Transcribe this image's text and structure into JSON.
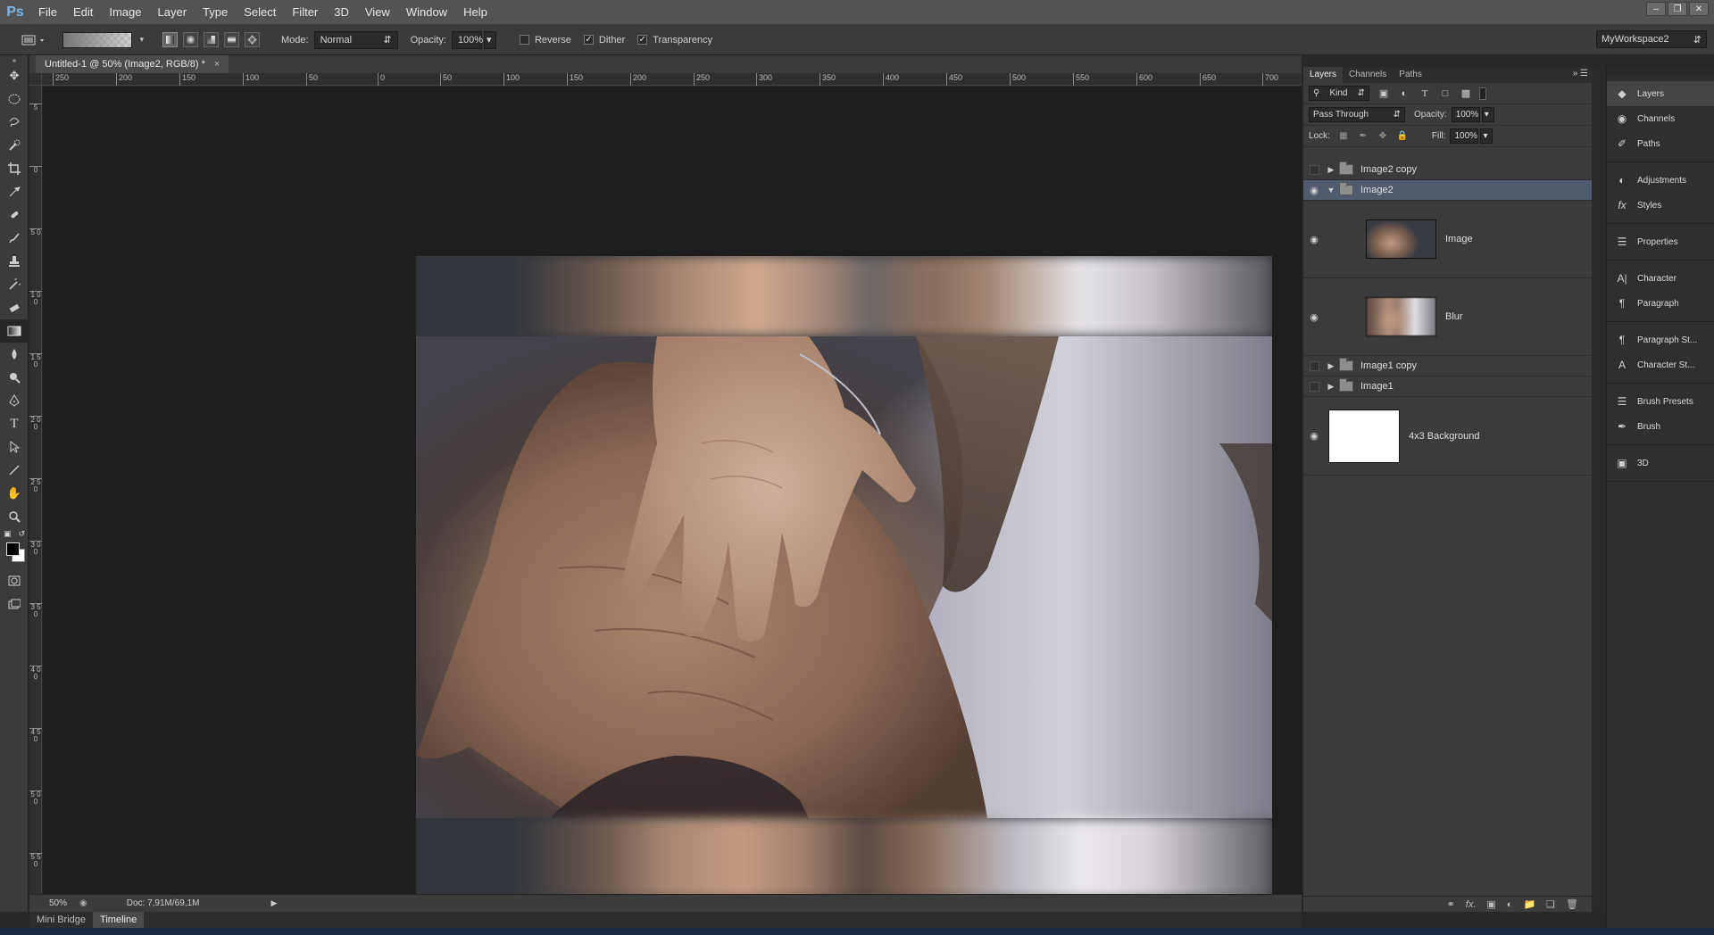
{
  "app": {
    "logo": "Ps"
  },
  "menu": [
    "File",
    "Edit",
    "Image",
    "Layer",
    "Type",
    "Select",
    "Filter",
    "3D",
    "View",
    "Window",
    "Help"
  ],
  "options": {
    "mode_label": "Mode:",
    "mode_value": "Normal",
    "opacity_label": "Opacity:",
    "opacity_value": "100%",
    "reverse_label": "Reverse",
    "reverse_checked": false,
    "dither_label": "Dither",
    "dither_checked": true,
    "transparency_label": "Transparency",
    "transparency_checked": true,
    "workspace": "MyWorkspace2"
  },
  "document": {
    "tab_title": "Untitled-1 @ 50% (Image2, RGB/8) *",
    "ruler_h": [
      "250",
      "200",
      "150",
      "100",
      "50",
      "0",
      "50",
      "100",
      "150",
      "200",
      "250",
      "300",
      "350",
      "400",
      "450",
      "500",
      "550",
      "600",
      "650",
      "700"
    ],
    "ruler_v": [
      "5",
      "0",
      "5 0",
      "1 0 0",
      "1 5 0",
      "2 0 0",
      "2 5 0",
      "3 0 0",
      "3 5 0",
      "4 0 0",
      "4 5 0",
      "5 0 0",
      "5 5 0"
    ]
  },
  "status": {
    "zoom": "50%",
    "doc_info": "Doc: 7,91M/69,1M"
  },
  "bottom_tabs": [
    "Mini Bridge",
    "Timeline"
  ],
  "layers_panel": {
    "tabs": [
      "Layers",
      "Channels",
      "Paths"
    ],
    "filter_kind": "Kind",
    "blend_mode": "Pass Through",
    "opacity_label": "Opacity:",
    "opacity_value": "100%",
    "lock_label": "Lock:",
    "fill_label": "Fill:",
    "fill_value": "100%",
    "layers": [
      {
        "name": "Image2 copy",
        "type": "group",
        "visible": false,
        "expanded": false
      },
      {
        "name": "Image2",
        "type": "group",
        "visible": true,
        "expanded": true,
        "selected": true
      },
      {
        "name": "Image",
        "type": "smart",
        "visible": true
      },
      {
        "name": "Blur",
        "type": "smart",
        "visible": true
      },
      {
        "name": "Image1 copy",
        "type": "group",
        "visible": false,
        "expanded": false
      },
      {
        "name": "Image1",
        "type": "group",
        "visible": false,
        "expanded": false
      },
      {
        "name": "4x3 Background",
        "type": "fill",
        "visible": true
      }
    ]
  },
  "dock": {
    "groups": [
      [
        "Layers",
        "Channels",
        "Paths"
      ],
      [
        "Adjustments",
        "Styles"
      ],
      [
        "Properties"
      ],
      [
        "Character",
        "Paragraph"
      ],
      [
        "Paragraph St...",
        "Character St..."
      ],
      [
        "Brush Presets",
        "Brush"
      ],
      [
        "3D"
      ]
    ]
  },
  "colors": {
    "accent_selected": "#505b6e",
    "foreground": "#000000",
    "background": "#ffffff"
  }
}
